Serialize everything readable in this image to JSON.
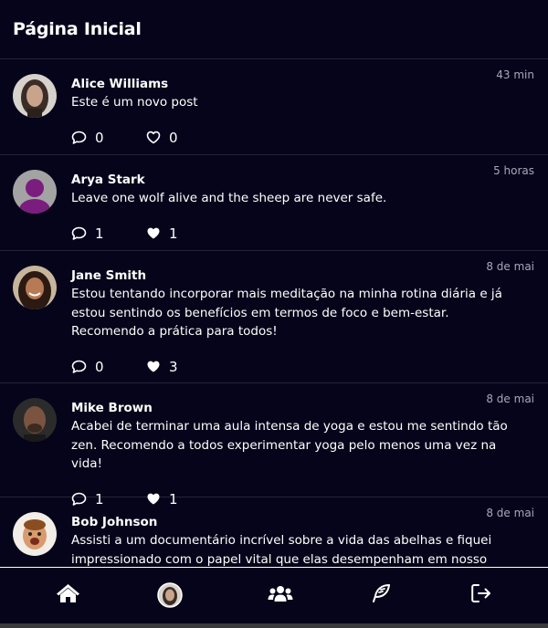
{
  "header": {
    "title": "Página Inicial"
  },
  "posts": [
    {
      "author": "Alice Williams",
      "time": "43 min",
      "content": "Este é um novo post",
      "comments": "0",
      "likes": "0",
      "liked": false
    },
    {
      "author": "Arya Stark",
      "time": "5 horas",
      "content": "Leave one wolf alive and the sheep are never safe.",
      "comments": "1",
      "likes": "1",
      "liked": true
    },
    {
      "author": "Jane Smith",
      "time": "8 de mai",
      "content": "Estou tentando incorporar mais meditação na minha rotina diária e já estou sentindo os benefícios em termos de foco e bem-estar. Recomendo a prática para todos!",
      "comments": "0",
      "likes": "3",
      "liked": true
    },
    {
      "author": "Mike Brown",
      "time": "8 de mai",
      "content": "Acabei de terminar uma aula intensa de yoga e estou me sentindo tão zen. Recomendo a todos experimentar yoga pelo menos uma vez na vida!",
      "comments": "1",
      "likes": "1",
      "liked": true
    },
    {
      "author": "Bob Johnson",
      "time": "8 de mai",
      "content": "Assisti a um documentário incrível sobre a vida das abelhas e fiquei impressionado com o papel vital que elas desempenham em nosso ecossistema.",
      "comments": "",
      "likes": "",
      "liked": true
    }
  ],
  "nav": {
    "items": [
      "home-icon",
      "profile-avatar",
      "users-icon",
      "feather-icon",
      "logout-icon"
    ]
  },
  "colors": {
    "background": "#06041a",
    "divider": "#262438",
    "text": "#ffffff",
    "muted": "#a9a7b8"
  }
}
